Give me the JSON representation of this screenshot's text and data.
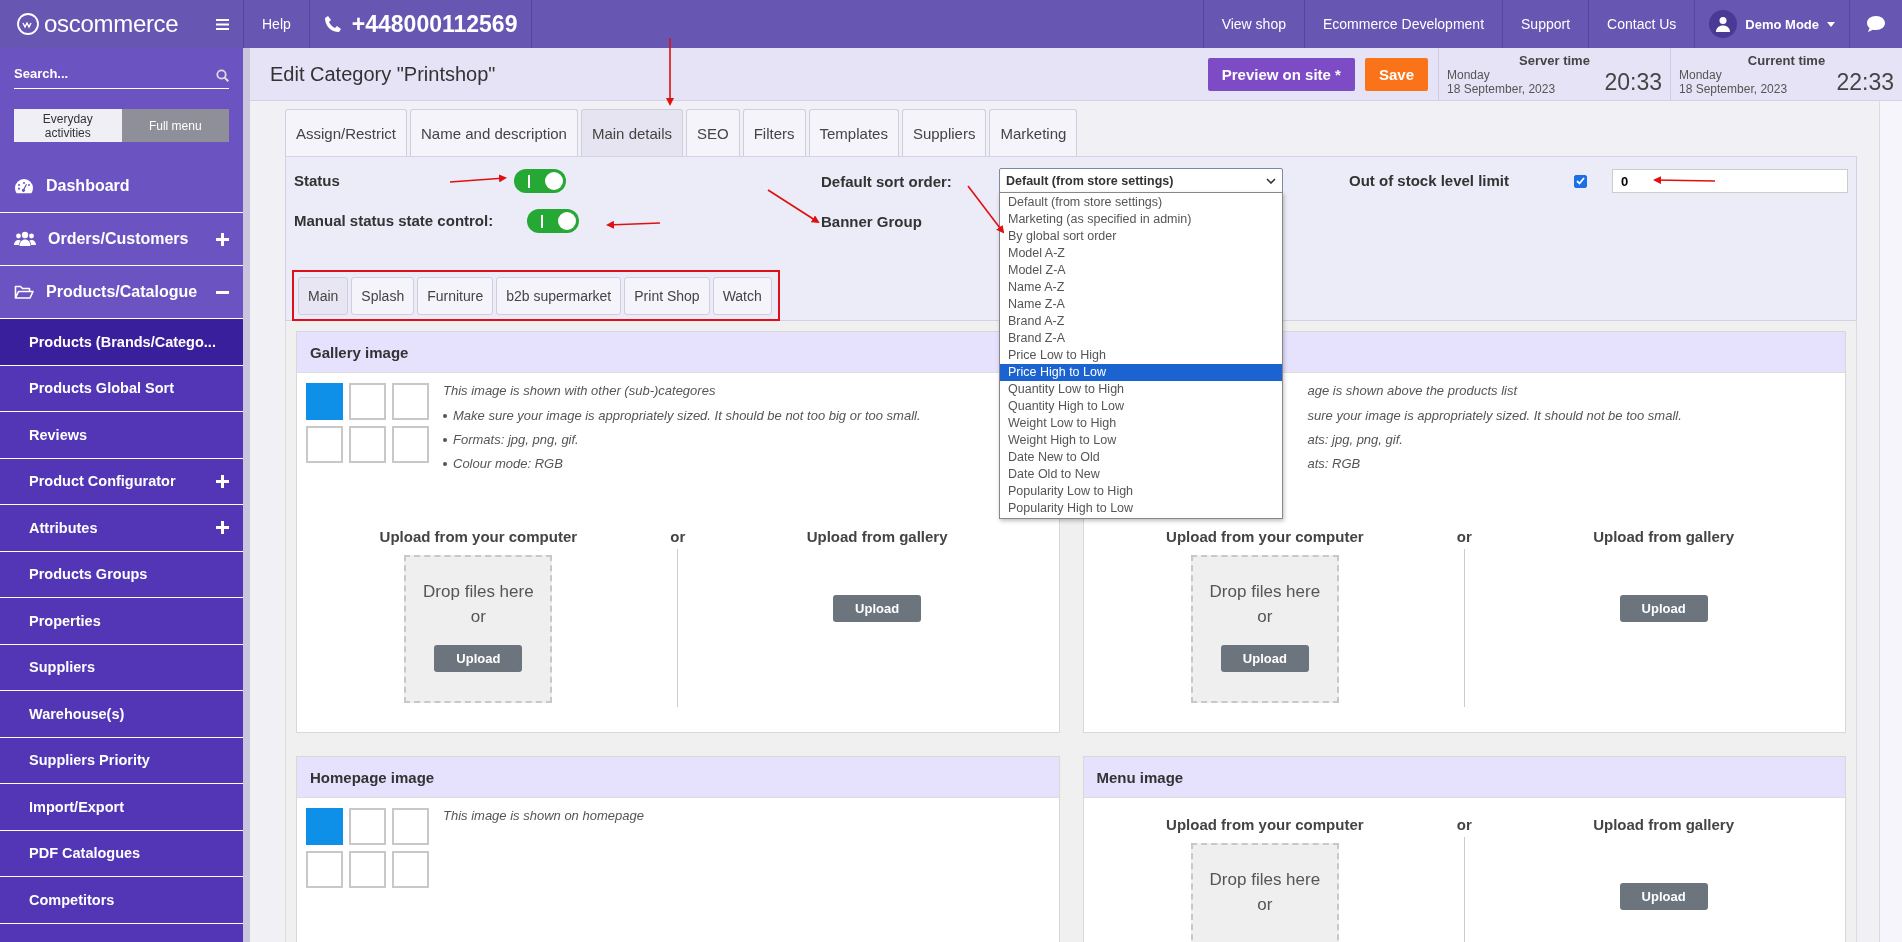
{
  "topbar": {
    "logo": "oscommerce",
    "help": "Help",
    "phone": "+448000112569",
    "links": [
      "View shop",
      "Ecommerce Development",
      "Support",
      "Contact Us"
    ],
    "user": "Demo Mode"
  },
  "sidebar": {
    "search": {
      "placeholder": "Search..."
    },
    "modes": [
      {
        "label": "Everyday activities",
        "selected": false
      },
      {
        "label": "Full menu",
        "selected": true
      }
    ],
    "items": [
      {
        "label": "Dashboard"
      },
      {
        "label": "Orders/Customers",
        "expanded": false
      },
      {
        "label": "Products/Catalogue",
        "expanded": true,
        "children": [
          {
            "label": "Products (Brands/Catego...",
            "selected": true
          },
          {
            "label": "Products Global Sort",
            "selected": false
          },
          {
            "label": "Reviews",
            "selected": false
          },
          {
            "label": "Product Configurator",
            "selected": false,
            "expanded": false
          },
          {
            "label": "Attributes",
            "selected": false,
            "expanded": false
          },
          {
            "label": "Products Groups",
            "selected": false
          },
          {
            "label": "Properties",
            "selected": false
          },
          {
            "label": "Suppliers",
            "selected": false
          },
          {
            "label": "Warehouse(s)",
            "selected": false
          },
          {
            "label": "Suppliers Priority",
            "selected": false
          },
          {
            "label": "Import/Export",
            "selected": false
          },
          {
            "label": "PDF Catalogues",
            "selected": false
          },
          {
            "label": "Competitors",
            "selected": false
          }
        ]
      }
    ]
  },
  "header": {
    "title": "Edit Category \"Printshop\"",
    "buttons": [
      {
        "label": "Preview on site *",
        "kind": "preview"
      },
      {
        "label": "Save",
        "kind": "save"
      }
    ],
    "clocks": [
      {
        "label": "Server time",
        "day": "Monday",
        "date": "18 September, 2023",
        "time": "20:33"
      },
      {
        "label": "Current time",
        "day": "Monday",
        "date": "18 September, 2023",
        "time": "22:33"
      }
    ]
  },
  "tabs": [
    {
      "label": "Assign/Restrict",
      "selected": false
    },
    {
      "label": "Name and description",
      "selected": false
    },
    {
      "label": "Main details",
      "selected": true
    },
    {
      "label": "SEO",
      "selected": false
    },
    {
      "label": "Filters",
      "selected": false
    },
    {
      "label": "Templates",
      "selected": false
    },
    {
      "label": "Suppliers",
      "selected": false
    },
    {
      "label": "Marketing",
      "selected": false
    }
  ],
  "form": {
    "status": {
      "label": "Status",
      "on": true
    },
    "manual_status": {
      "label": "Manual status state control:",
      "on": true
    },
    "sort_order": {
      "label": "Default sort order:",
      "value": "Default (from store settings)",
      "expanded": true,
      "options": [
        {
          "label": "Default (from store settings)",
          "highlighted": false
        },
        {
          "label": "Marketing (as specified in admin)",
          "highlighted": false
        },
        {
          "label": "By global sort order",
          "highlighted": false
        },
        {
          "label": "Model A-Z",
          "highlighted": false
        },
        {
          "label": "Model Z-A",
          "highlighted": false
        },
        {
          "label": "Name A-Z",
          "highlighted": false
        },
        {
          "label": "Name Z-A",
          "highlighted": false
        },
        {
          "label": "Brand A-Z",
          "highlighted": false
        },
        {
          "label": "Brand Z-A",
          "highlighted": false
        },
        {
          "label": "Price Low to High",
          "highlighted": false
        },
        {
          "label": "Price High to Low",
          "highlighted": true
        },
        {
          "label": "Quantity Low to High",
          "highlighted": false
        },
        {
          "label": "Quantity High to Low",
          "highlighted": false
        },
        {
          "label": "Weight Low to High",
          "highlighted": false
        },
        {
          "label": "Weight High to Low",
          "highlighted": false
        },
        {
          "label": "Date New to Old",
          "highlighted": false
        },
        {
          "label": "Date Old to New",
          "highlighted": false
        },
        {
          "label": "Popularity Low to High",
          "highlighted": false
        },
        {
          "label": "Popularity High to Low",
          "highlighted": false
        }
      ]
    },
    "banner_group": {
      "label": "Banner Group"
    },
    "out_of_stock": {
      "label": "Out of stock level limit",
      "checked": true,
      "value": "0"
    }
  },
  "subtabs": [
    {
      "label": "Main",
      "selected": true
    },
    {
      "label": "Splash",
      "selected": false
    },
    {
      "label": "Furniture",
      "selected": false
    },
    {
      "label": "b2b supermarket",
      "selected": false
    },
    {
      "label": "Print Shop",
      "selected": false
    },
    {
      "label": "Watch",
      "selected": false
    }
  ],
  "cards": [
    {
      "title": "Gallery image",
      "thumbnails": [
        {
          "selected": true
        },
        {
          "selected": false
        },
        {
          "selected": false
        },
        {
          "selected": false
        },
        {
          "selected": false
        },
        {
          "selected": false
        }
      ],
      "note": "This image is shown with other (sub-)categores",
      "bullets": [
        "Make sure your image is appropriately sized. It should be not too big or too small.",
        "Formats: jpg, png, gif.",
        "Colour mode: RGB"
      ],
      "upload": {
        "computer_label": "Upload from your computer",
        "drop_text": "Drop files here",
        "drop_or": "or",
        "computer_button": "Upload",
        "or": "or",
        "gallery_label": "Upload from gallery",
        "gallery_button": "Upload"
      }
    },
    {
      "note": "age is shown above the products list",
      "fragments": [
        "sure your image is appropriately sized. It should not be too small.",
        "ats: jpg, png, gif.",
        "ats: RGB"
      ],
      "upload": {
        "computer_label": "Upload from your computer",
        "drop_text": "Drop files here",
        "drop_or": "or",
        "computer_button": "Upload",
        "or": "or",
        "gallery_label": "Upload from gallery",
        "gallery_button": "Upload"
      }
    },
    {
      "title": "Homepage image",
      "thumbnails": [
        {
          "selected": true
        },
        {
          "selected": false
        },
        {
          "selected": false
        },
        {
          "selected": false
        },
        {
          "selected": false
        },
        {
          "selected": false
        }
      ],
      "note": "This image is shown on homepage"
    },
    {
      "title": "Menu image",
      "upload": {
        "computer_label": "Upload from your computer",
        "drop_text": "Drop files here",
        "drop_or": "or",
        "or": "or",
        "gallery_label": "Upload from gallery",
        "gallery_button": "Upload"
      }
    }
  ]
}
